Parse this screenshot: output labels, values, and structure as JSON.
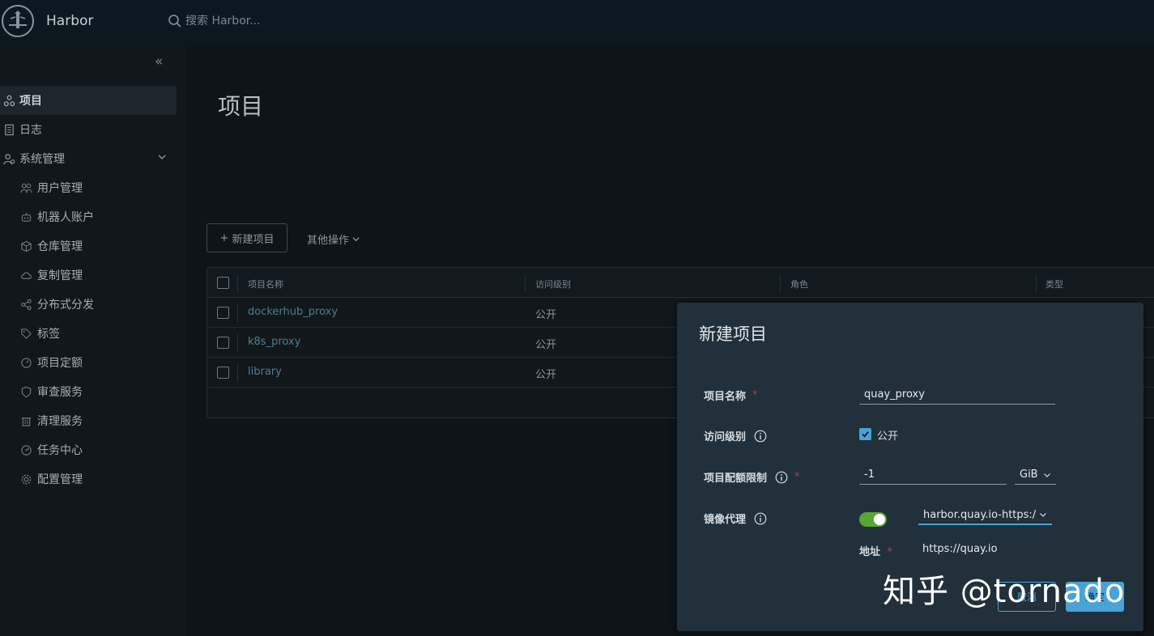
{
  "header": {
    "brand": "Harbor",
    "search_placeholder": "搜索 Harbor..."
  },
  "sidebar": {
    "items": [
      {
        "label": "项目",
        "icon": "projects-icon",
        "active": true
      },
      {
        "label": "日志",
        "icon": "logs-icon"
      },
      {
        "label": "系统管理",
        "icon": "admin-icon",
        "expandable": true
      }
    ],
    "sub_items": [
      {
        "label": "用户管理",
        "icon": "users-icon"
      },
      {
        "label": "机器人账户",
        "icon": "robot-icon"
      },
      {
        "label": "仓库管理",
        "icon": "registry-icon"
      },
      {
        "label": "复制管理",
        "icon": "replication-icon"
      },
      {
        "label": "分布式分发",
        "icon": "share-icon"
      },
      {
        "label": "标签",
        "icon": "tag-icon"
      },
      {
        "label": "项目定额",
        "icon": "quota-icon"
      },
      {
        "label": "审查服务",
        "icon": "shield-icon"
      },
      {
        "label": "清理服务",
        "icon": "trash-icon"
      },
      {
        "label": "任务中心",
        "icon": "dashboard-icon"
      },
      {
        "label": "配置管理",
        "icon": "gear-icon"
      }
    ]
  },
  "main": {
    "title": "项目",
    "new_project_label": "新建项目",
    "other_actions_label": "其他操作"
  },
  "table": {
    "columns": [
      "项目名称",
      "访问级别",
      "角色",
      "类型"
    ],
    "rows": [
      {
        "name": "dockerhub_proxy",
        "access": "公开"
      },
      {
        "name": "k8s_proxy",
        "access": "公开"
      },
      {
        "name": "library",
        "access": "公开"
      }
    ]
  },
  "modal": {
    "title": "新建项目",
    "name_label": "项目名称",
    "name_value": "quay_proxy",
    "access_label": "访问级别",
    "public_label": "公开",
    "public_checked": true,
    "quota_label": "项目配额限制",
    "quota_value": "-1",
    "quota_unit": "GiB",
    "proxy_label": "镜像代理",
    "proxy_enabled": true,
    "proxy_registry": "harbor.quay.io-https:/",
    "address_label": "地址",
    "address_value": "https://quay.io",
    "cancel_label": "取消",
    "ok_label": "确定",
    "required_mark": "*"
  },
  "watermark": "知乎 @tornado",
  "colors": {
    "accent": "#49a3d6",
    "toggle_on": "#5aa534",
    "modal_bg": "#21303a",
    "required": "#c23b3b"
  }
}
